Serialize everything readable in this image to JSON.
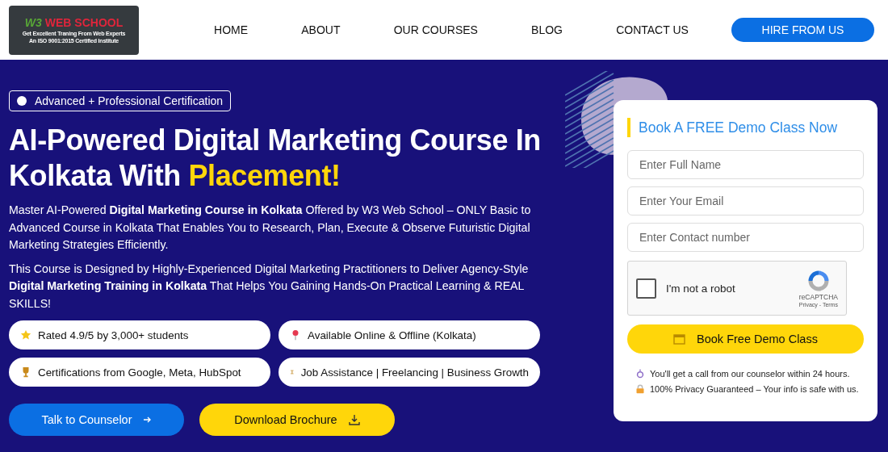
{
  "logo": {
    "mark": "W3",
    "name": "WEB SCHOOL",
    "tagline": "Get Excellent Traning From Web Experts",
    "certification": "An ISO 9001:2015 Certified Institute"
  },
  "nav": [
    {
      "label": "HOME"
    },
    {
      "label": "ABOUT"
    },
    {
      "label": "OUR COURSES"
    },
    {
      "label": "BLOG"
    },
    {
      "label": "CONTACT US"
    }
  ],
  "nav_button": "HIRE FROM US",
  "hero": {
    "badge": "Advanced + Professional Certification",
    "title": "AI-Powered Digital Marketing Course In Kolkata With",
    "title_highlight": "Placement!",
    "paragraphs": [
      "Master AI-Powered **Digital Marketing Course in Kolkata** Offered by W3 Web School – ONLY Basic to Advanced Course in Kolkata That Enables You to Research, Plan, Execute & Observe Futuristic Digital Marketing Strategies Efficiently.",
      "This Course is Designed by Highly-Experienced Digital Marketing Practitioners to Deliver Agency-Style **Digital Marketing Training in Kolkata** That Helps You Gaining Hands-On Practical Learning & REAL SKILLS!"
    ],
    "features": [
      {
        "kind": "star",
        "label": "Rated 4.9/5 by 3,000+ students"
      },
      {
        "kind": "pin",
        "label": "Available Online & Offline (Kolkata)"
      },
      {
        "kind": "trophy",
        "label": "Certifications from Google, Meta, HubSpot"
      },
      {
        "kind": "hourglass",
        "label": "Job Assistance | Freelancing | Business Growth"
      }
    ],
    "primary_button": "Talk to Counselor",
    "secondary_button": "Download Brochure"
  },
  "form": {
    "title": "Book A FREE Demo Class Now",
    "fields": [
      {
        "placeholder": "Enter Full Name"
      },
      {
        "placeholder": "Enter Your Email"
      },
      {
        "placeholder": "Enter Contact number"
      }
    ],
    "captcha": {
      "label": "I'm not a robot",
      "checked": false,
      "brand": "reCAPTCHA",
      "links": "Privacy - Terms"
    },
    "submit": "Book Free Demo Class",
    "notes": [
      {
        "kind": "stopwatch",
        "text": "You'll get a call from our counselor within 24 hours."
      },
      {
        "kind": "lock",
        "text": "100% Privacy Guaranteed – Your info is safe with us."
      }
    ]
  }
}
